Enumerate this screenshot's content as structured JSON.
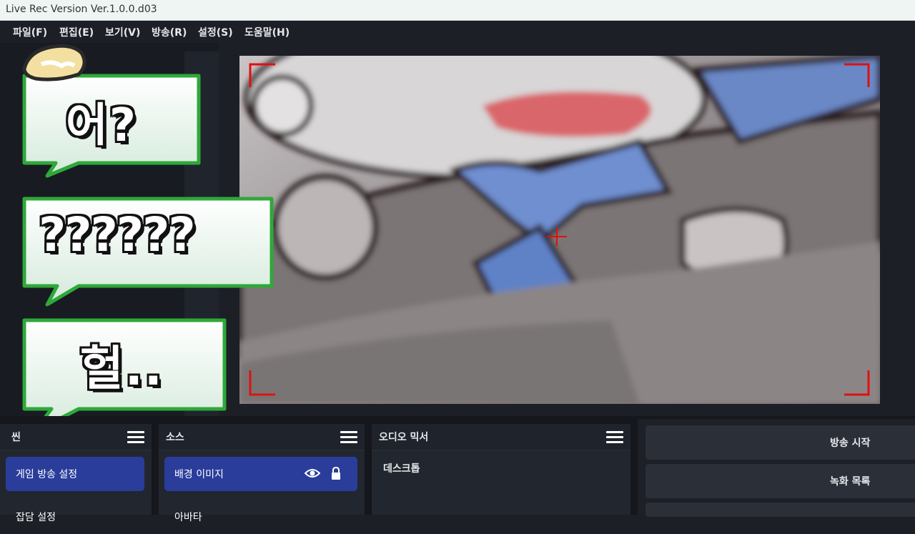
{
  "window": {
    "title": "Live Rec Version Ver.1.0.0.d03"
  },
  "menu": [
    "파일(F)",
    "편집(E)",
    "보기(V)",
    "방송(R)",
    "설정(S)",
    "도움말(H)"
  ],
  "bubbles": [
    "어?",
    "??????",
    "헐.."
  ],
  "scenes": {
    "header": "씬",
    "items": [
      "게임 방송 설정",
      "잡담 설정"
    ]
  },
  "sources": {
    "header": "소스",
    "items": [
      "배경 이미지",
      "아바타"
    ]
  },
  "audio": {
    "header": "오디오 믹서",
    "items": [
      "데스크톱"
    ]
  },
  "controls": [
    "방송 시작",
    "녹화 목록"
  ],
  "colors": {
    "accent": "#2a3d9b",
    "bubble_border": "#2fa83a",
    "rec_marker": "#e01010"
  }
}
